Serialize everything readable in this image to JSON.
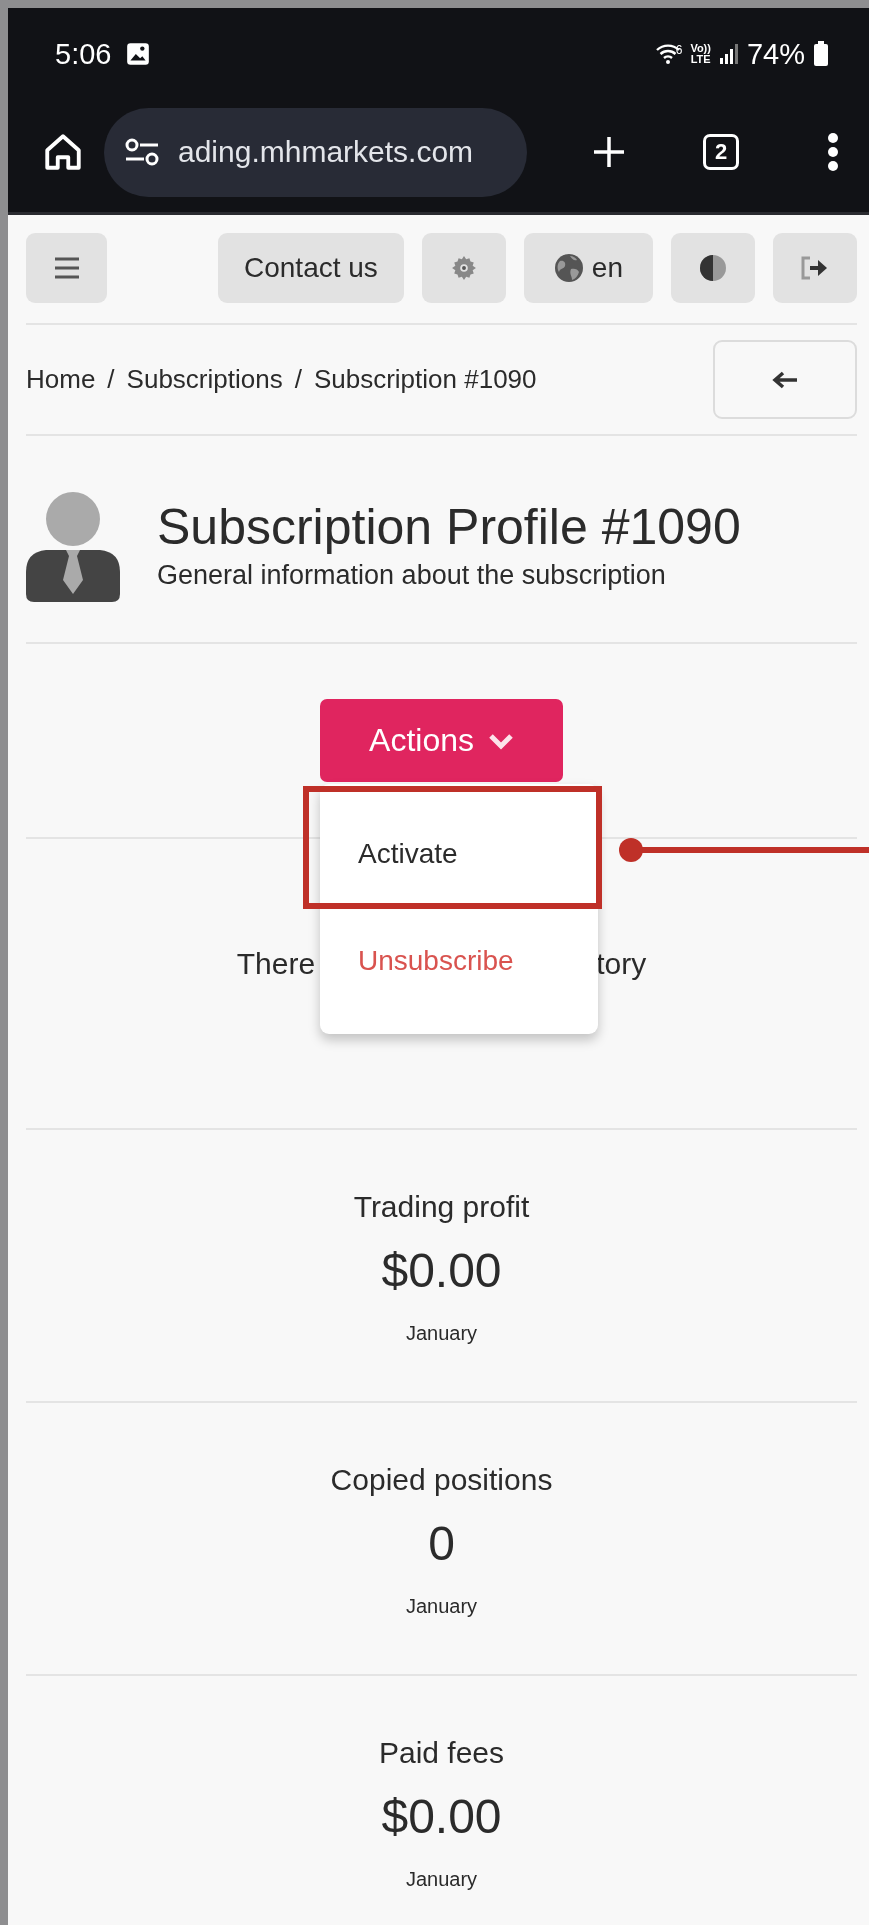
{
  "status_bar": {
    "time": "5:06",
    "wifi_badge": "6",
    "network_top": "Vo))",
    "network_bottom": "LTE",
    "battery": "74%"
  },
  "browser": {
    "url": "ading.mhmarkets.com",
    "tab_count": "2"
  },
  "toolbar": {
    "buttons": [
      {
        "kind": "menu"
      },
      {
        "kind": "text",
        "label": "Contact us"
      },
      {
        "kind": "settings"
      },
      {
        "kind": "language",
        "label": "en"
      },
      {
        "kind": "theme"
      },
      {
        "kind": "logout"
      }
    ]
  },
  "breadcrumb": {
    "items": [
      {
        "kind": "link",
        "text": "Home"
      },
      {
        "kind": "separator",
        "text": "/"
      },
      {
        "kind": "link",
        "text": "Subscriptions"
      },
      {
        "kind": "separator",
        "text": "/"
      },
      {
        "kind": "current",
        "text": "Subscription #1090"
      }
    ]
  },
  "profile": {
    "title": "Subscription Profile #1090",
    "subtitle": "General information about the subscription"
  },
  "actions": {
    "label": "Actions",
    "expanded": true,
    "items": [
      {
        "label": "Activate",
        "kind": "normal",
        "highlighted": true
      },
      {
        "label": "Unsubscribe",
        "kind": "danger",
        "highlighted": false
      }
    ]
  },
  "history_message": {
    "visible_parts": [
      "There",
      "tory"
    ]
  },
  "stats": [
    {
      "label": "Trading profit",
      "value": "$0.00",
      "period": "January"
    },
    {
      "label": "Copied positions",
      "value": "0",
      "period": "January"
    },
    {
      "label": "Paid fees",
      "value": "$0.00",
      "period": "January"
    }
  ]
}
